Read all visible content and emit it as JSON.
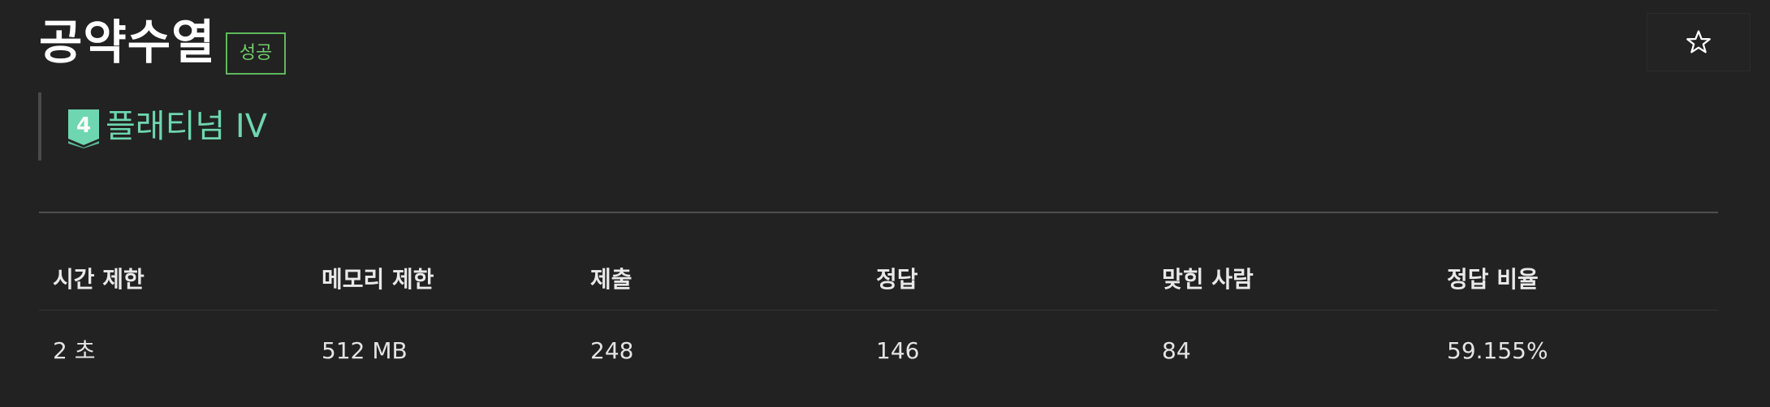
{
  "problem": {
    "title": "공약수열",
    "status_badge": "성공",
    "tier": {
      "label": "플래티넘 IV",
      "level": "4",
      "color": "#6ed6b0"
    },
    "star_icon": "star-outline-icon"
  },
  "info_table": {
    "headers": [
      "시간 제한",
      "메모리 제한",
      "제출",
      "정답",
      "맞힌 사람",
      "정답 비율"
    ],
    "values": [
      "2 초",
      "512 MB",
      "248",
      "146",
      "84",
      "59.155%"
    ]
  },
  "colors": {
    "background": "#222222",
    "success_badge": "#6fcf6b",
    "tier_platinum": "#6ed6b0"
  }
}
